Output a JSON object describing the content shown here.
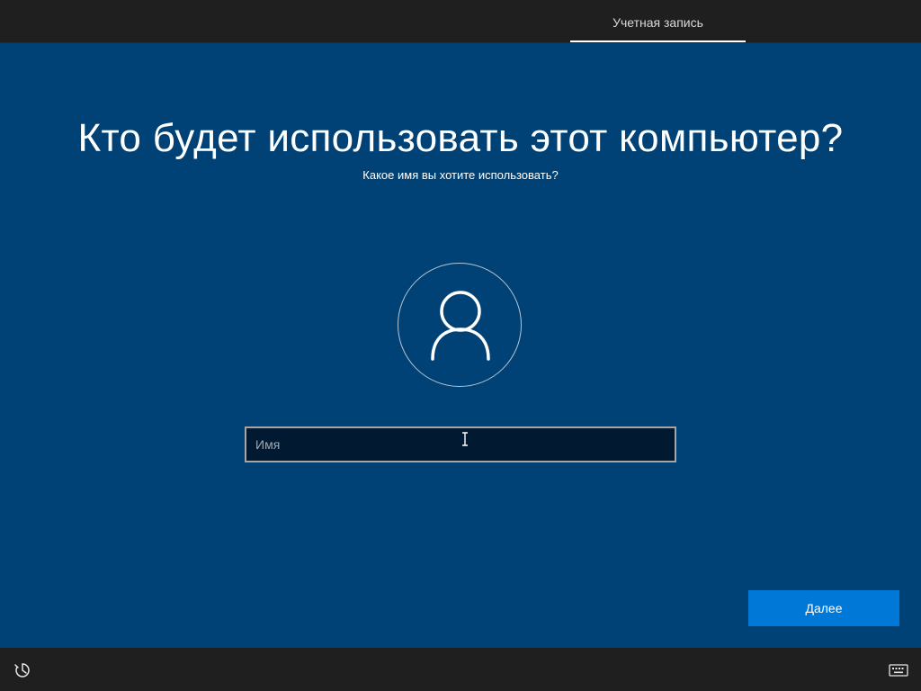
{
  "header": {
    "tabs": [
      {
        "label": "Учетная запись",
        "active": true
      }
    ]
  },
  "main": {
    "title": "Кто будет использовать этот компьютер?",
    "subtitle": "Какое имя вы хотите использовать?",
    "avatar_icon": "user-icon",
    "name_field": {
      "placeholder": "Имя",
      "value": ""
    },
    "next_label": "Далее"
  },
  "footer": {
    "left_icon": "accessibility-icon",
    "right_icon": "keyboard-icon"
  },
  "colors": {
    "background": "#004275",
    "bar": "#1f1f1f",
    "accent": "#0078d7",
    "input_background": "#011a31"
  }
}
